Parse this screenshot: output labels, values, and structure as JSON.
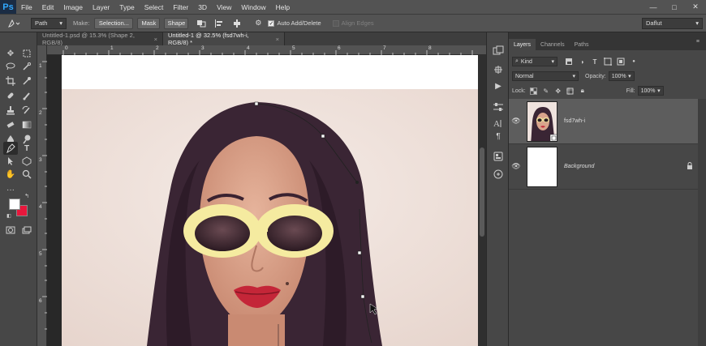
{
  "app": {
    "logo": "Ps"
  },
  "menu": [
    "File",
    "Edit",
    "Image",
    "Layer",
    "Type",
    "Select",
    "Filter",
    "3D",
    "View",
    "Window",
    "Help"
  ],
  "window_controls": {
    "minimize": "—",
    "maximize": "□",
    "close": "✕"
  },
  "options": {
    "mode_value": "Path",
    "make_label": "Make:",
    "selection_btn": "Selection...",
    "mask_btn": "Mask",
    "shape_btn": "Shape",
    "auto_add_delete": "Auto Add/Delete",
    "align_edges": "Align Edges",
    "workspace_value": "Daflut"
  },
  "tabs": [
    {
      "label": "Untitled-1.psd @ 15.3% (Shape 2, RGB/8)",
      "close": "×"
    },
    {
      "label": "Untitled-1 @ 32.5% (fsd7wh-i, RGB/8) *",
      "close": "×"
    }
  ],
  "ruler": {
    "top_numbers": [
      "0",
      "1",
      "2",
      "3",
      "4",
      "5",
      "6",
      "7",
      "8"
    ],
    "left_numbers": [
      "1",
      "2",
      "3",
      "4",
      "5",
      "6"
    ]
  },
  "colors": {
    "foreground": "#ffffff",
    "background": "#e8173c",
    "accent": "#31a8ff",
    "panel": "#474747"
  },
  "layers_panel": {
    "tabs": [
      "Layers",
      "Channels",
      "Paths"
    ],
    "kind_filter": "Kind",
    "blend_mode": "Normal",
    "opacity_label": "Opacity:",
    "opacity_value": "100%",
    "lock_label": "Lock:",
    "fill_label": "Fill:",
    "fill_value": "100%",
    "layers": [
      {
        "name": "fsd7wh-i",
        "selected": true
      },
      {
        "name": "Background",
        "selected": false,
        "locked": true
      }
    ]
  }
}
